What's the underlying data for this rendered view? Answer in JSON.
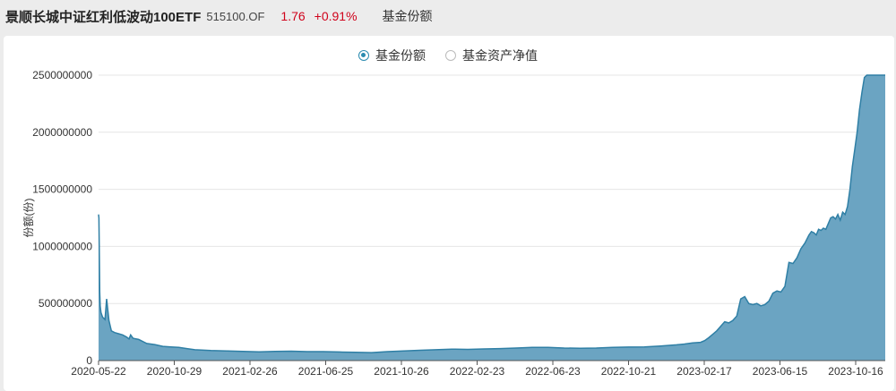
{
  "header": {
    "fund_name": "景顺长城中证红利低波动100ETF",
    "fund_code": "515100.OF",
    "price": "1.76",
    "change": "+0.91%",
    "view_label": "基金份额"
  },
  "legend": {
    "items": [
      {
        "label": "基金份额",
        "selected": true
      },
      {
        "label": "基金资产净值",
        "selected": false
      }
    ]
  },
  "colors": {
    "area_fill": "#6ba4c2",
    "line": "#2f7fa5",
    "radio_active": "#2a8bb0",
    "positive": "#d0021b"
  },
  "chart_data": {
    "type": "area",
    "title": "",
    "xlabel": "",
    "ylabel": "份额(份)",
    "ylim": [
      0,
      2500000000
    ],
    "yticks": [
      "0",
      "500000000",
      "1000000000",
      "1500000000",
      "2000000000",
      "2500000000"
    ],
    "xticks": [
      "2020-05-22",
      "2020-10-29",
      "2021-02-26",
      "2021-06-25",
      "2021-10-26",
      "2022-02-23",
      "2022-06-23",
      "2022-10-21",
      "2023-02-17",
      "2023-06-15",
      "2023-10-16"
    ],
    "grid": true,
    "series": [
      {
        "name": "基金份额",
        "x": [
          0,
          0.5,
          1,
          1.5,
          2,
          3,
          5,
          8,
          10,
          13,
          16,
          20,
          25,
          30,
          35,
          38,
          40,
          43,
          50,
          60,
          70,
          80,
          90,
          100,
          110,
          120,
          140,
          160,
          180,
          200,
          220,
          240,
          260,
          280,
          300,
          320,
          340,
          360,
          380,
          400,
          420,
          440,
          460,
          480,
          500,
          520,
          540,
          560,
          580,
          600,
          620,
          640,
          660,
          680,
          700,
          720,
          730,
          740,
          750,
          755,
          760,
          765,
          770,
          775,
          780,
          785,
          790,
          795,
          800,
          805,
          810,
          815,
          820,
          825,
          830,
          835,
          840,
          845,
          850,
          855,
          860,
          865,
          870,
          875,
          880,
          885,
          888,
          891,
          894,
          897,
          900,
          903,
          906,
          909,
          912,
          915,
          918,
          921,
          924,
          927,
          930,
          933,
          936,
          939,
          942,
          945,
          948,
          951,
          954,
          957,
          960,
          963,
          966,
          969,
          972,
          975,
          978,
          980
        ],
        "values": [
          1280000000,
          1250000000,
          900000000,
          600000000,
          480000000,
          420000000,
          380000000,
          360000000,
          540000000,
          350000000,
          260000000,
          245000000,
          235000000,
          225000000,
          205000000,
          190000000,
          225000000,
          195000000,
          185000000,
          150000000,
          140000000,
          125000000,
          120000000,
          115000000,
          105000000,
          95000000,
          88000000,
          85000000,
          80000000,
          77000000,
          80000000,
          82000000,
          78000000,
          78000000,
          75000000,
          72000000,
          70000000,
          78000000,
          85000000,
          90000000,
          95000000,
          100000000,
          98000000,
          102000000,
          105000000,
          110000000,
          115000000,
          115000000,
          110000000,
          108000000,
          110000000,
          115000000,
          118000000,
          120000000,
          128000000,
          138000000,
          145000000,
          155000000,
          160000000,
          175000000,
          200000000,
          230000000,
          260000000,
          300000000,
          340000000,
          330000000,
          350000000,
          390000000,
          540000000,
          560000000,
          500000000,
          490000000,
          500000000,
          480000000,
          490000000,
          520000000,
          590000000,
          610000000,
          600000000,
          650000000,
          860000000,
          850000000,
          900000000,
          980000000,
          1030000000,
          1100000000,
          1130000000,
          1120000000,
          1100000000,
          1150000000,
          1140000000,
          1160000000,
          1150000000,
          1200000000,
          1250000000,
          1260000000,
          1240000000,
          1280000000,
          1230000000,
          1300000000,
          1280000000,
          1350000000,
          1500000000,
          1700000000,
          1850000000,
          2000000000,
          2200000000,
          2350000000,
          2480000000,
          2500000000,
          2500000000,
          2500000000,
          2500000000,
          2500000000,
          2500000000,
          2500000000,
          2500000000,
          2500000000
        ]
      }
    ]
  }
}
